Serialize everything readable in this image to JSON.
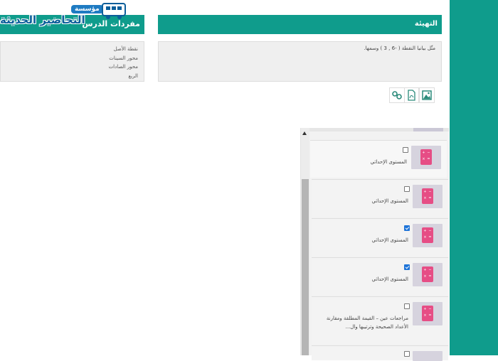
{
  "logo": {
    "small_text": "مؤسسة",
    "big_text": "التحاضير الحديثة",
    "bus_icon": "bus-icon"
  },
  "vocabulary": {
    "title": "مفردات الدرس",
    "items": [
      "نقطة الأصل",
      "محور السينات",
      "محور الصادات",
      "الربع"
    ]
  },
  "warmup": {
    "title": "التهيئة",
    "prompt": "مثّل بيانيا النقطة ( -6 , 3 ) وسمها."
  },
  "tools": [
    "image-icon",
    "pdf-icon",
    "link-icon"
  ],
  "lessons": [
    {
      "label": "المستوى الإحداثي",
      "checked": false
    },
    {
      "label": "المستوى الإحداثي",
      "checked": false
    },
    {
      "label": "المستوى الإحداثي",
      "checked": true
    },
    {
      "label": "المستوى الإحداثي",
      "checked": true
    },
    {
      "label": "مراجعات عين – القيمة المطلقة ومقارنة الأعداد الصحيحة وترتيبها وال...",
      "checked": false
    },
    {
      "label": "",
      "checked": false
    }
  ],
  "colors": {
    "accent": "#0f9c8c",
    "calc": "#e64d85",
    "checkbox": "#1e74d8"
  }
}
